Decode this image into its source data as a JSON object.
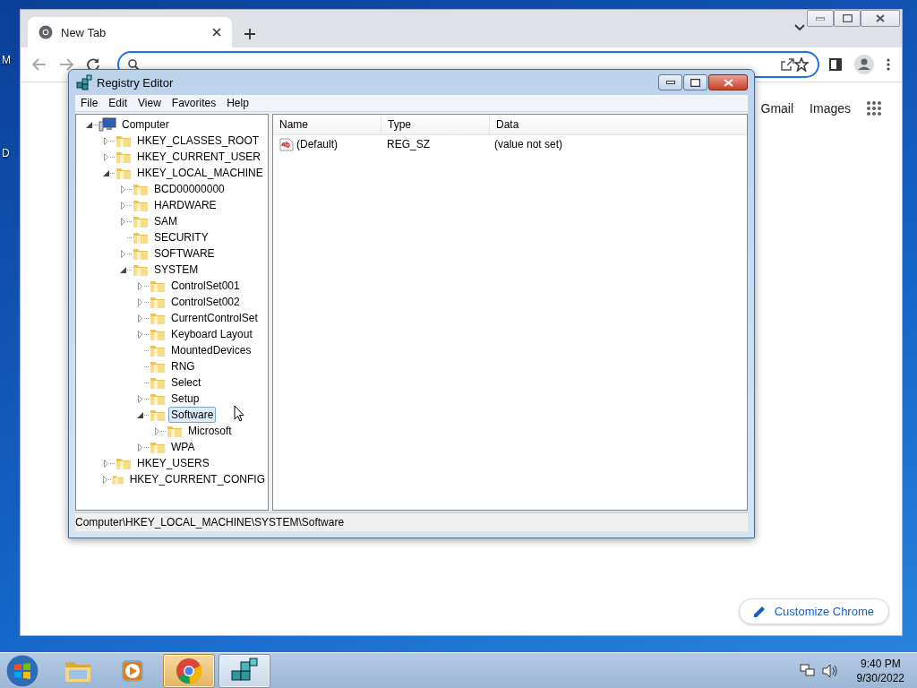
{
  "desktop": {
    "icon_labels": [
      "M",
      "D"
    ]
  },
  "browser": {
    "tabs": [
      {
        "title": "New Tab",
        "selected": true
      }
    ],
    "links": [
      "Gmail",
      "Images"
    ],
    "customize_button": "Customize Chrome"
  },
  "registry_editor": {
    "title": "Registry Editor",
    "menu": [
      "File",
      "Edit",
      "View",
      "Favorites",
      "Help"
    ],
    "tree": [
      {
        "label": "Computer",
        "kind": "expanded",
        "selected": false,
        "children": [
          {
            "label": "HKEY_CLASSES_ROOT",
            "kind": "collapsed",
            "selected": false
          },
          {
            "label": "HKEY_CURRENT_USER",
            "kind": "collapsed",
            "selected": false
          },
          {
            "label": "HKEY_LOCAL_MACHINE",
            "kind": "expanded",
            "selected": false,
            "children": [
              {
                "label": "BCD00000000",
                "kind": "collapsed",
                "selected": false
              },
              {
                "label": "HARDWARE",
                "kind": "collapsed",
                "selected": false
              },
              {
                "label": "SAM",
                "kind": "collapsed",
                "selected": false
              },
              {
                "label": "SECURITY",
                "kind": "leaf",
                "selected": false
              },
              {
                "label": "SOFTWARE",
                "kind": "collapsed",
                "selected": false
              },
              {
                "label": "SYSTEM",
                "kind": "expanded",
                "selected": false,
                "children": [
                  {
                    "label": "ControlSet001",
                    "kind": "collapsed",
                    "selected": false
                  },
                  {
                    "label": "ControlSet002",
                    "kind": "collapsed",
                    "selected": false
                  },
                  {
                    "label": "CurrentControlSet",
                    "kind": "collapsed",
                    "selected": false
                  },
                  {
                    "label": "Keyboard Layout",
                    "kind": "collapsed",
                    "selected": false
                  },
                  {
                    "label": "MountedDevices",
                    "kind": "leaf",
                    "selected": false
                  },
                  {
                    "label": "RNG",
                    "kind": "leaf",
                    "selected": false
                  },
                  {
                    "label": "Select",
                    "kind": "leaf",
                    "selected": false
                  },
                  {
                    "label": "Setup",
                    "kind": "collapsed",
                    "selected": false
                  },
                  {
                    "label": "Software",
                    "kind": "expanded",
                    "selected": true,
                    "children": [
                      {
                        "label": "Microsoft",
                        "kind": "collapsed",
                        "selected": false
                      }
                    ]
                  },
                  {
                    "label": "WPA",
                    "kind": "collapsed",
                    "selected": false
                  }
                ]
              }
            ]
          },
          {
            "label": "HKEY_USERS",
            "kind": "collapsed",
            "selected": false
          },
          {
            "label": "HKEY_CURRENT_CONFIG",
            "kind": "collapsed",
            "selected": false
          }
        ]
      }
    ],
    "columns": [
      "Name",
      "Type",
      "Data"
    ],
    "values": [
      {
        "name": "(Default)",
        "type": "REG_SZ",
        "data": "(value not set)"
      }
    ],
    "status_bar": "Computer\\HKEY_LOCAL_MACHINE\\SYSTEM\\Software"
  },
  "taskbar": {
    "apps": [
      {
        "kind": "explorer",
        "open": false,
        "highlighted": false
      },
      {
        "kind": "media",
        "open": false,
        "highlighted": false
      },
      {
        "kind": "browser",
        "open": true,
        "highlighted": true
      },
      {
        "kind": "registry",
        "open": true,
        "highlighted": false
      }
    ],
    "time": "9:40 PM",
    "date": "9/30/2022"
  }
}
